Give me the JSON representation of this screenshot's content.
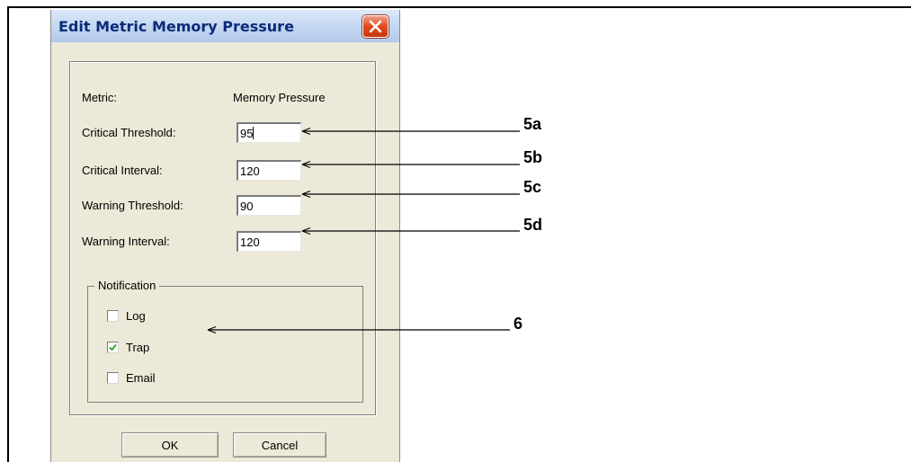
{
  "dialog": {
    "title": "Edit Metric Memory Pressure",
    "metric_label": "Metric:",
    "metric_value": "Memory Pressure",
    "fields": [
      {
        "label": "Critical Threshold:",
        "value": "95"
      },
      {
        "label": "Critical Interval:",
        "value": "120"
      },
      {
        "label": "Warning Threshold:",
        "value": "90"
      },
      {
        "label": "Warning Interval:",
        "value": "120"
      }
    ],
    "notification": {
      "legend": "Notification",
      "options": [
        {
          "label": "Log",
          "checked": false
        },
        {
          "label": "Trap",
          "checked": true
        },
        {
          "label": "Email",
          "checked": false
        }
      ]
    },
    "ok_label": "OK",
    "cancel_label": "Cancel",
    "close_icon": "close-icon"
  },
  "callouts": [
    "5a",
    "5b",
    "5c",
    "5d",
    "6"
  ]
}
